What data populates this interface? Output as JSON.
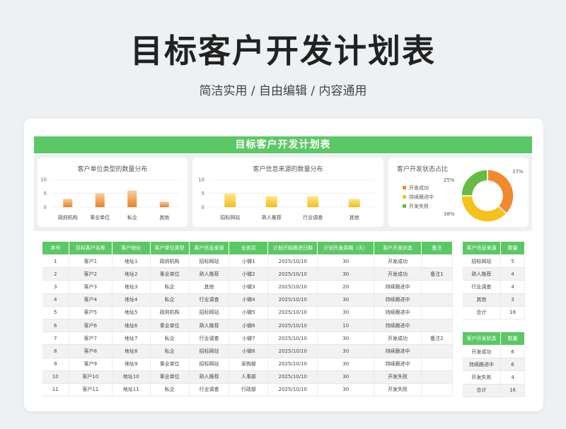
{
  "page": {
    "title": "目标客户开发计划表",
    "subtitle": "简洁实用 / 自由编辑 / 内容通用"
  },
  "sheet": {
    "header": "目标客户开发计划表"
  },
  "colors": {
    "green": "#5bc865",
    "orange": "#f08a2c",
    "yellow": "#f5c21b",
    "leaf": "#66bb44"
  },
  "charts": {
    "unit_type": {
      "title": "客户单位类型的数量分布",
      "yticks": [
        "10",
        "5",
        "0"
      ]
    },
    "source": {
      "title": "客户信息来源的数量分布",
      "yticks": [
        "10",
        "5",
        "0"
      ]
    },
    "status": {
      "title": "客户开发状态占比",
      "legend": [
        "开发成功",
        "持续跟进中",
        "开发失败"
      ],
      "labels": [
        "25%",
        "37%",
        "38%"
      ]
    }
  },
  "chart_data": [
    {
      "type": "bar",
      "title": "客户单位类型的数量分布",
      "categories": [
        "政府机构",
        "事业单位",
        "私企",
        "其他"
      ],
      "values": [
        3,
        5,
        6,
        2
      ],
      "ylim": [
        0,
        10
      ]
    },
    {
      "type": "bar",
      "title": "客户信息来源的数量分布",
      "categories": [
        "招标网站",
        "熟人推荐",
        "行业调查",
        "其他"
      ],
      "values": [
        5,
        4,
        4,
        3
      ],
      "ylim": [
        0,
        10
      ]
    },
    {
      "type": "pie",
      "title": "客户开发状态占比",
      "categories": [
        "开发成功",
        "持续跟进中",
        "开发失败"
      ],
      "values": [
        37,
        38,
        25
      ]
    }
  ],
  "main_table": {
    "headers": [
      "序号",
      "目标客户名称",
      "客户地址",
      "客户单位类型",
      "客户信息来源",
      "业务员",
      "计划开始跟进日期",
      "计划开发周期（天）",
      "客户开发状态",
      "备注"
    ],
    "rows": [
      [
        "1",
        "客户1",
        "地址1",
        "政府机构",
        "招标网站",
        "小微1",
        "2025/10/10",
        "30",
        "开发成功",
        ""
      ],
      [
        "2",
        "客户2",
        "地址2",
        "事业单位",
        "熟人推荐",
        "小微2",
        "2025/10/10",
        "30",
        "开发成功",
        "备注1"
      ],
      [
        "3",
        "客户3",
        "地址3",
        "私企",
        "其他",
        "小微3",
        "2025/10/10",
        "20",
        "持续跟进中",
        ""
      ],
      [
        "4",
        "客户4",
        "地址4",
        "私企",
        "行业调查",
        "小微4",
        "2025/10/10",
        "30",
        "持续跟进中",
        ""
      ],
      [
        "5",
        "客户5",
        "地址5",
        "政府机构",
        "招标网站",
        "小微5",
        "2025/10/10",
        "30",
        "持续跟进中",
        ""
      ],
      [
        "6",
        "客户6",
        "地址6",
        "事业单位",
        "熟人推荐",
        "小微6",
        "2025/10/10",
        "10",
        "持续跟进中",
        ""
      ],
      [
        "7",
        "客户7",
        "地址7",
        "私企",
        "行业调查",
        "小微7",
        "2025/10/10",
        "30",
        "开发成功",
        "备注2"
      ],
      [
        "8",
        "客户8",
        "地址8",
        "私企",
        "招标网站",
        "小微8",
        "2025/10/10",
        "30",
        "持续跟进中",
        ""
      ],
      [
        "9",
        "客户9",
        "地址9",
        "事业单位",
        "招标网站",
        "采购部",
        "2025/10/10",
        "30",
        "持续跟进中",
        ""
      ],
      [
        "10",
        "客户10",
        "地址10",
        "事业单位",
        "熟人推荐",
        "人事部",
        "2025/10/10",
        "30",
        "开发失败",
        ""
      ],
      [
        "11",
        "客户11",
        "地址11",
        "私企",
        "行业调查",
        "行政部",
        "2025/10/10",
        "30",
        "开发失败",
        ""
      ]
    ]
  },
  "source_table": {
    "headers": [
      "客户信息来源",
      "数量"
    ],
    "rows": [
      [
        "招标网站",
        "5"
      ],
      [
        "熟人推荐",
        "4"
      ],
      [
        "行业调查",
        "4"
      ],
      [
        "其他",
        "3"
      ],
      [
        "合计",
        "16"
      ]
    ]
  },
  "status_table": {
    "headers": [
      "客户开发状态",
      "数量"
    ],
    "rows": [
      [
        "开发成功",
        "6"
      ],
      [
        "持续跟进中",
        "6"
      ],
      [
        "开发失败",
        "4"
      ],
      [
        "合计",
        "16"
      ]
    ]
  }
}
